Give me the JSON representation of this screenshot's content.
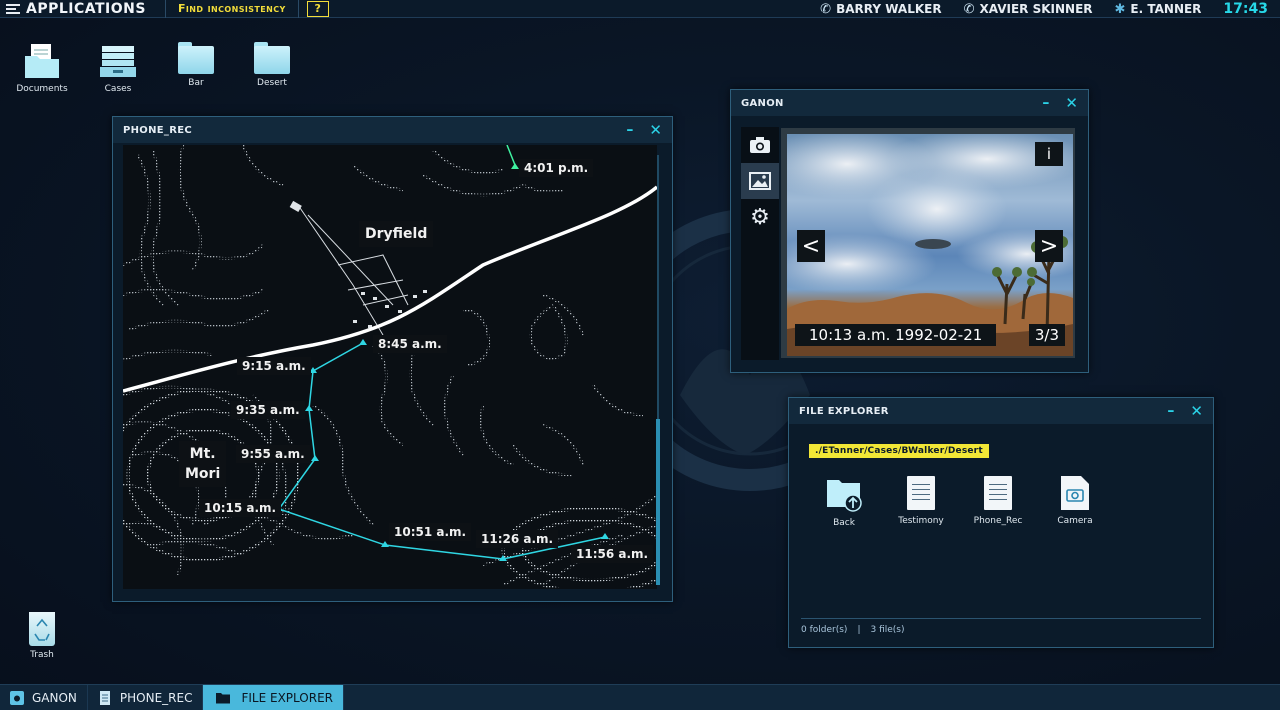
{
  "topbar": {
    "apps_label": "APPLICATIONS",
    "find_label": "Find inconsistency",
    "help_label": "?",
    "contacts": [
      {
        "name": "BARRY WALKER",
        "icon": "phone-icon"
      },
      {
        "name": "XAVIER SKINNER",
        "icon": "phone-icon"
      },
      {
        "name": "E. TANNER",
        "icon": "verified-badge-icon"
      }
    ],
    "clock": "17:43"
  },
  "desktop": {
    "icons": [
      {
        "label": "Documents",
        "icon": "documents-folder-icon"
      },
      {
        "label": "Cases",
        "icon": "cases-drawer-icon"
      },
      {
        "label": "Bar",
        "icon": "folder-icon"
      },
      {
        "label": "Desert",
        "icon": "folder-icon"
      }
    ],
    "trash_label": "Trash"
  },
  "phone_rec": {
    "title": "PHONE_REC",
    "places": {
      "dryfield": "Dryfield",
      "mt_mori_1": "Mt.",
      "mt_mori_2": "Mori"
    },
    "timestamps": [
      "4:01 p.m.",
      "8:45 a.m.",
      "9:15 a.m.",
      "9:35 a.m.",
      "9:55 a.m.",
      "10:15 a.m.",
      "10:51 a.m.",
      "11:26 a.m.",
      "11:56 a.m."
    ],
    "colors": {
      "route": "#2fd6e3",
      "route_alt": "#3ff0a0",
      "road": "#ffffff"
    }
  },
  "ganon": {
    "title": "GANON",
    "tools": [
      "camera-icon",
      "image-icon",
      "gear-icon"
    ],
    "info_label": "i",
    "prev_label": "<",
    "next_label": ">",
    "caption": "10:13 a.m. 1992-02-21",
    "index": "3/3"
  },
  "file_explorer": {
    "title": "FILE EXPLORER",
    "path": "./ETanner/Cases/BWalker/Desert",
    "items": [
      {
        "label": "Back",
        "icon": "folder-up-icon"
      },
      {
        "label": "Testimony",
        "icon": "document-icon"
      },
      {
        "label": "Phone_Rec",
        "icon": "document-icon"
      },
      {
        "label": "Camera",
        "icon": "camera-file-icon"
      }
    ],
    "folders": "0 folder(s)",
    "separator": "|",
    "files": "3 file(s)"
  },
  "taskbar": {
    "tasks": [
      {
        "label": "GANON",
        "icon": "camera-icon"
      },
      {
        "label": "PHONE_REC",
        "icon": "document-icon"
      },
      {
        "label": "FILE EXPLORER",
        "icon": "folder-icon"
      }
    ]
  },
  "colors": {
    "accent": "#27d8e8",
    "highlight": "#f2dd3a",
    "active_task": "#49b8dc"
  }
}
